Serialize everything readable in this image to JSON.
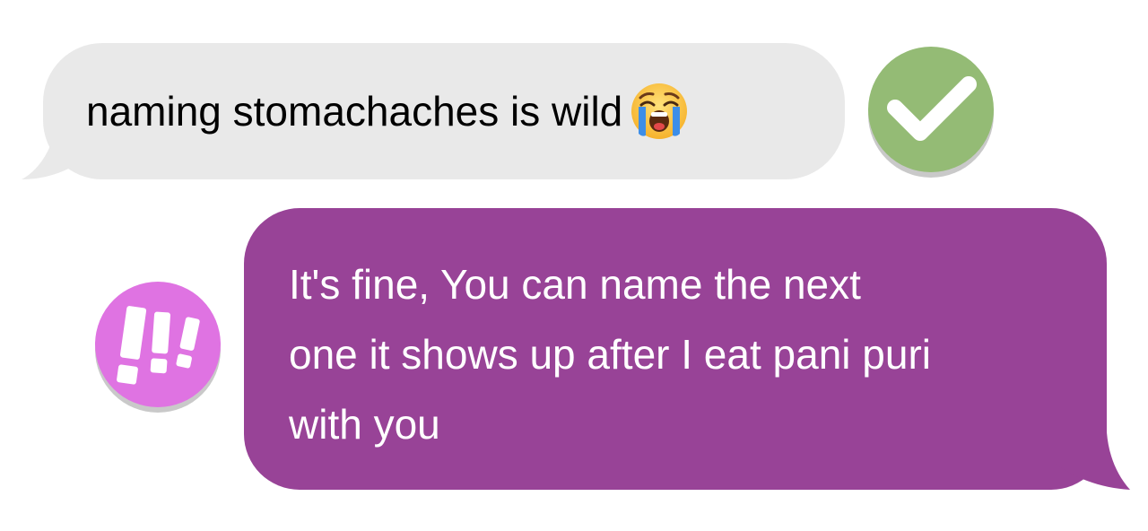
{
  "received_message": {
    "text": "naming stomachaches is wild",
    "emoji_icon": "loudly-crying-face-icon"
  },
  "sent_message": {
    "lines": [
      "It's fine, You can name the next",
      "one it shows up after I eat pani puri",
      "with you"
    ]
  },
  "reactions": {
    "received": "checkmark-icon",
    "sent": "exclamation-marks-icon"
  },
  "colors": {
    "received_bubble": "#e9e9e9",
    "sent_bubble": "#984397",
    "check_reaction": "#94bb75",
    "exclaim_reaction": "#df73e2"
  }
}
